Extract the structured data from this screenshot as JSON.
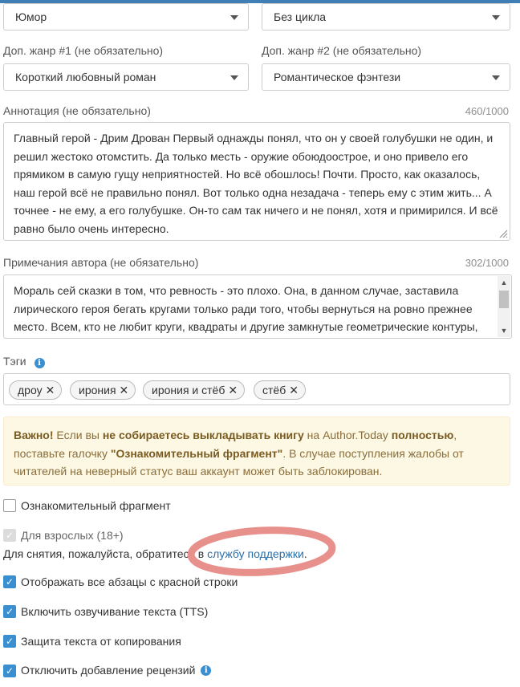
{
  "genre_select": {
    "value": "Юмор"
  },
  "cycle_select": {
    "value": "Без цикла"
  },
  "extra_genre1": {
    "label": "Доп. жанр #1 (не обязательно)",
    "value": "Короткий любовный роман"
  },
  "extra_genre2": {
    "label": "Доп. жанр #2 (не обязательно)",
    "value": "Романтическое фэнтези"
  },
  "annotation": {
    "label": "Аннотация (не обязательно)",
    "counter": "460/1000",
    "text": "Главный герой - Дрим Дрован Первый однажды понял, что он у своей голубушки не один, и решил жестоко отомстить. Да только месть - оружие обоюдоострое, и оно привело его прямиком в самую гущу неприятностей. Но всё обошлось! Почти. Просто, как оказалось, наш герой всё не правильно понял. Вот только одна незадача - теперь ему с этим жить... А точнее - не ему, а его голубушке. Он-то сам так ничего и не понял, хотя и примирился. И всё равно было очень интересно."
  },
  "author_notes": {
    "label": "Примечания автора (не обязательно)",
    "counter": "302/1000",
    "text": "Мораль сей сказки в том, что ревность - это плохо. Она, в данном случае, заставила лирического героя бегать кругами только ради того, чтобы вернуться на ровно прежнее место. Всем, кто не любит круги, квадраты и другие замкнутые геометрические контуры, рекомендую не ревновать понапрасну."
  },
  "tags": {
    "label": "Тэги",
    "items": [
      "дроу",
      "ирония",
      "ирония и стёб",
      "стёб"
    ],
    "remove_glyph": "✕"
  },
  "warning": {
    "p1": "Важно!",
    "p2": " Если вы ",
    "p3": "не собираетесь выкладывать книгу",
    "p4": " на Author.Today ",
    "p5": "полностью",
    "p6": ", поставьте галочку ",
    "p7": "\"Ознакомительный фрагмент\"",
    "p8": ". В случае поступления жалобы от читателей на неверный статус ваш аккаунт может быть заблокирован."
  },
  "options": {
    "preview": {
      "label": "Ознакомительный фрагмент",
      "checked": false
    },
    "adult": {
      "label": "Для взрослых (18+)",
      "checked": true,
      "disabled": true
    },
    "adult_note": "Для снятия, пожалуйста, обратитесь в ",
    "adult_link": "службу поддержки",
    "adult_note_end": ".",
    "red_line": {
      "label": "Отображать все абзацы с красной строки",
      "checked": true
    },
    "tts": {
      "label": "Включить озвучивание текста (TTS)",
      "checked": true
    },
    "copy_protect": {
      "label": "Защита текста от копирования",
      "checked": true
    },
    "disable_reviews": {
      "label": "Отключить добавление рецензий",
      "checked": true
    }
  },
  "colors": {
    "accent": "#3a8fd1",
    "warning_bg": "#fcf8e3",
    "warning_text": "#8a6d3b",
    "link": "#2a6ea8",
    "annotation_ellipse": "#e8908b"
  },
  "icons": {
    "info": "info-circle-icon",
    "caret": "caret-down-icon",
    "check": "checkmark-icon",
    "remove": "close-icon",
    "resize": "resize-grip-icon"
  }
}
